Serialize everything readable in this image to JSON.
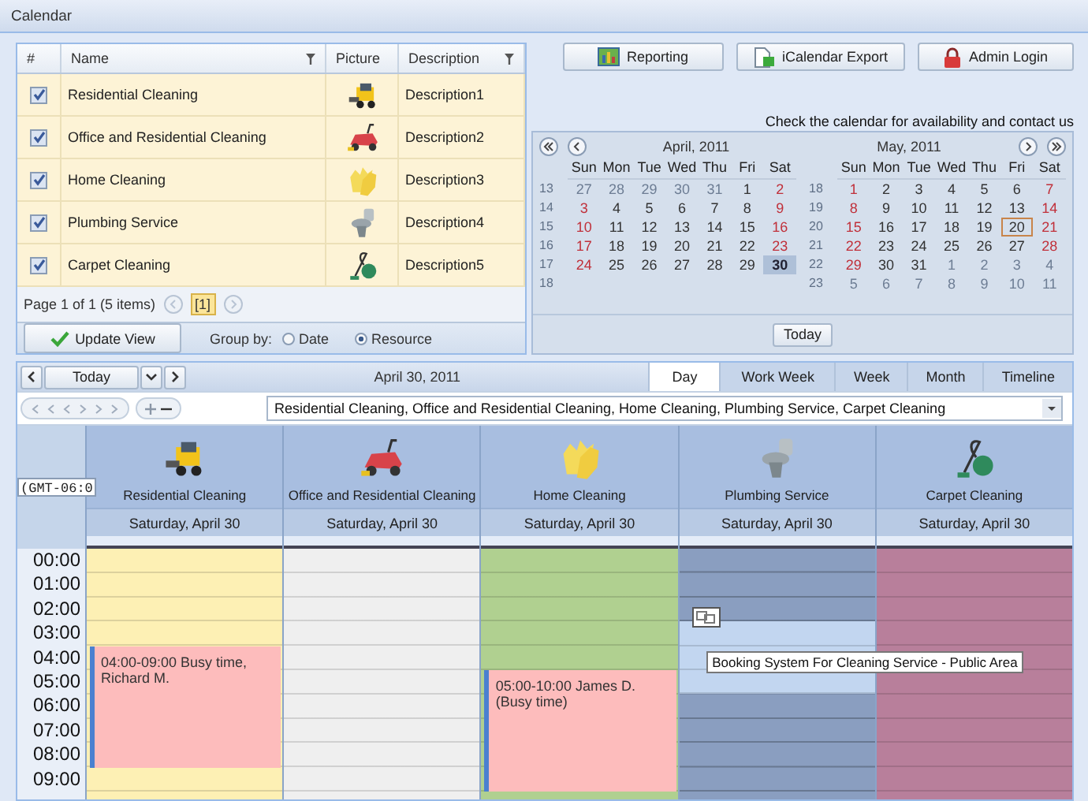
{
  "window": {
    "title": "Calendar"
  },
  "grid": {
    "columns": [
      {
        "label": "#",
        "filter": false
      },
      {
        "label": "Name",
        "filter": true
      },
      {
        "label": "Picture",
        "filter": false
      },
      {
        "label": "Description",
        "filter": true
      }
    ],
    "rows": [
      {
        "checked": true,
        "name": "Residential Cleaning",
        "description": "Description1"
      },
      {
        "checked": true,
        "name": "Office and Residential Cleaning",
        "description": "Description2"
      },
      {
        "checked": true,
        "name": "Home Cleaning",
        "description": "Description3"
      },
      {
        "checked": true,
        "name": "Plumbing Service",
        "description": "Description4"
      },
      {
        "checked": true,
        "name": "Carpet Cleaning",
        "description": "Description5"
      }
    ],
    "pager": {
      "text": "Page 1 of 1 (5 items)",
      "pages": [
        {
          "label": "[1]",
          "selected": true
        }
      ]
    },
    "update_button": "Update View",
    "group_by": {
      "label": "Group by:",
      "options": [
        {
          "label": "Date",
          "selected": false
        },
        {
          "label": "Resource",
          "selected": true
        }
      ]
    }
  },
  "buttons": [
    "Reporting",
    "iCalendar Export",
    "Admin Login"
  ],
  "notice": "Check the calendar for availability and contact us",
  "mini_calendar": {
    "today_button": "Today",
    "months": [
      {
        "title": "April, 2011",
        "day_names": [
          "Sun",
          "Mon",
          "Tue",
          "Wed",
          "Thu",
          "Fri",
          "Sat"
        ],
        "weeks": [
          {
            "number": "13",
            "days": [
              {
                "d": "27",
                "other": true,
                "selected": false,
                "today": false
              },
              {
                "d": "28",
                "other": true,
                "selected": false,
                "today": false
              },
              {
                "d": "29",
                "other": true,
                "selected": false,
                "today": false
              },
              {
                "d": "30",
                "other": true,
                "selected": false,
                "today": false
              },
              {
                "d": "31",
                "other": true,
                "selected": false,
                "today": false
              },
              {
                "d": "1",
                "other": false,
                "selected": false,
                "today": false
              },
              {
                "d": "2",
                "other": false,
                "selected": false,
                "today": false
              }
            ]
          },
          {
            "number": "14",
            "days": [
              {
                "d": "3",
                "other": false,
                "selected": false,
                "today": false
              },
              {
                "d": "4",
                "other": false,
                "selected": false,
                "today": false
              },
              {
                "d": "5",
                "other": false,
                "selected": false,
                "today": false
              },
              {
                "d": "6",
                "other": false,
                "selected": false,
                "today": false
              },
              {
                "d": "7",
                "other": false,
                "selected": false,
                "today": false
              },
              {
                "d": "8",
                "other": false,
                "selected": false,
                "today": false
              },
              {
                "d": "9",
                "other": false,
                "selected": false,
                "today": false
              }
            ]
          },
          {
            "number": "15",
            "days": [
              {
                "d": "10",
                "other": false,
                "selected": false,
                "today": false
              },
              {
                "d": "11",
                "other": false,
                "selected": false,
                "today": false
              },
              {
                "d": "12",
                "other": false,
                "selected": false,
                "today": false
              },
              {
                "d": "13",
                "other": false,
                "selected": false,
                "today": false
              },
              {
                "d": "14",
                "other": false,
                "selected": false,
                "today": false
              },
              {
                "d": "15",
                "other": false,
                "selected": false,
                "today": false
              },
              {
                "d": "16",
                "other": false,
                "selected": false,
                "today": false
              }
            ]
          },
          {
            "number": "16",
            "days": [
              {
                "d": "17",
                "other": false,
                "selected": false,
                "today": false
              },
              {
                "d": "18",
                "other": false,
                "selected": false,
                "today": false
              },
              {
                "d": "19",
                "other": false,
                "selected": false,
                "today": false
              },
              {
                "d": "20",
                "other": false,
                "selected": false,
                "today": false
              },
              {
                "d": "21",
                "other": false,
                "selected": false,
                "today": false
              },
              {
                "d": "22",
                "other": false,
                "selected": false,
                "today": false
              },
              {
                "d": "23",
                "other": false,
                "selected": false,
                "today": false
              }
            ]
          },
          {
            "number": "17",
            "days": [
              {
                "d": "24",
                "other": false,
                "selected": false,
                "today": false
              },
              {
                "d": "25",
                "other": false,
                "selected": false,
                "today": false
              },
              {
                "d": "26",
                "other": false,
                "selected": false,
                "today": false
              },
              {
                "d": "27",
                "other": false,
                "selected": false,
                "today": false
              },
              {
                "d": "28",
                "other": false,
                "selected": false,
                "today": false
              },
              {
                "d": "29",
                "other": false,
                "selected": false,
                "today": false
              },
              {
                "d": "30",
                "other": false,
                "selected": true,
                "today": false
              }
            ]
          },
          {
            "number": "18"
          }
        ]
      },
      {
        "title": "May, 2011",
        "day_names": [
          "Sun",
          "Mon",
          "Tue",
          "Wed",
          "Thu",
          "Fri",
          "Sat"
        ],
        "weeks": [
          {
            "number": "18",
            "days": [
              {
                "d": "1",
                "other": false,
                "selected": false,
                "today": false
              },
              {
                "d": "2",
                "other": false,
                "selected": false,
                "today": false
              },
              {
                "d": "3",
                "other": false,
                "selected": false,
                "today": false
              },
              {
                "d": "4",
                "other": false,
                "selected": false,
                "today": false
              },
              {
                "d": "5",
                "other": false,
                "selected": false,
                "today": false
              },
              {
                "d": "6",
                "other": false,
                "selected": false,
                "today": false
              },
              {
                "d": "7",
                "other": false,
                "selected": false,
                "today": false
              }
            ]
          },
          {
            "number": "19",
            "days": [
              {
                "d": "8",
                "other": false,
                "selected": false,
                "today": false
              },
              {
                "d": "9",
                "other": false,
                "selected": false,
                "today": false
              },
              {
                "d": "10",
                "other": false,
                "selected": false,
                "today": false
              },
              {
                "d": "11",
                "other": false,
                "selected": false,
                "today": false
              },
              {
                "d": "12",
                "other": false,
                "selected": false,
                "today": false
              },
              {
                "d": "13",
                "other": false,
                "selected": false,
                "today": false
              },
              {
                "d": "14",
                "other": false,
                "selected": false,
                "today": false
              }
            ]
          },
          {
            "number": "20",
            "days": [
              {
                "d": "15",
                "other": false,
                "selected": false,
                "today": false
              },
              {
                "d": "16",
                "other": false,
                "selected": false,
                "today": false
              },
              {
                "d": "17",
                "other": false,
                "selected": false,
                "today": false
              },
              {
                "d": "18",
                "other": false,
                "selected": false,
                "today": false
              },
              {
                "d": "19",
                "other": false,
                "selected": false,
                "today": false
              },
              {
                "d": "20",
                "other": false,
                "selected": false,
                "today": true
              },
              {
                "d": "21",
                "other": false,
                "selected": false,
                "today": false
              }
            ]
          },
          {
            "number": "21",
            "days": [
              {
                "d": "22",
                "other": false,
                "selected": false,
                "today": false
              },
              {
                "d": "23",
                "other": false,
                "selected": false,
                "today": false
              },
              {
                "d": "24",
                "other": false,
                "selected": false,
                "today": false
              },
              {
                "d": "25",
                "other": false,
                "selected": false,
                "today": false
              },
              {
                "d": "26",
                "other": false,
                "selected": false,
                "today": false
              },
              {
                "d": "27",
                "other": false,
                "selected": false,
                "today": false
              },
              {
                "d": "28",
                "other": false,
                "selected": false,
                "today": false
              }
            ]
          },
          {
            "number": "22",
            "days": [
              {
                "d": "29",
                "other": false,
                "selected": false,
                "today": false
              },
              {
                "d": "30",
                "other": false,
                "selected": false,
                "today": false
              },
              {
                "d": "31",
                "other": false,
                "selected": false,
                "today": false
              },
              {
                "d": "1",
                "other": true,
                "selected": false,
                "today": false
              },
              {
                "d": "2",
                "other": true,
                "selected": false,
                "today": false
              },
              {
                "d": "3",
                "other": true,
                "selected": false,
                "today": false
              },
              {
                "d": "4",
                "other": true,
                "selected": false,
                "today": false
              }
            ]
          },
          {
            "number": "23",
            "days": [
              {
                "d": "5",
                "other": true,
                "selected": false,
                "today": false
              },
              {
                "d": "6",
                "other": true,
                "selected": false,
                "today": false
              },
              {
                "d": "7",
                "other": true,
                "selected": false,
                "today": false
              },
              {
                "d": "8",
                "other": true,
                "selected": false,
                "today": false
              },
              {
                "d": "9",
                "other": true,
                "selected": false,
                "today": false
              },
              {
                "d": "10",
                "other": true,
                "selected": false,
                "today": false
              },
              {
                "d": "11",
                "other": true,
                "selected": false,
                "today": false
              }
            ]
          }
        ]
      }
    ]
  },
  "scheduler": {
    "today": "Today",
    "date": "April 30, 2011",
    "views": [
      {
        "label": "Day",
        "selected": true
      },
      {
        "label": "Work Week",
        "selected": false
      },
      {
        "label": "Week",
        "selected": false
      },
      {
        "label": "Month",
        "selected": false
      },
      {
        "label": "Timeline",
        "selected": false
      }
    ],
    "resource_filter": "Residential Cleaning, Office and Residential Cleaning, Home Cleaning, Plumbing Service, Carpet Cleaning",
    "timezone": "(GMT-06:0",
    "hours": [
      "00:00",
      "01:00",
      "02:00",
      "03:00",
      "04:00",
      "05:00",
      "06:00",
      "07:00",
      "08:00",
      "09:00"
    ],
    "resources": [
      {
        "name": "Residential Cleaning",
        "date": "Saturday, April 30",
        "color": "#fdf0b4",
        "events": [
          {
            "time": "04:00-09:00",
            "text": "Busy time, Richard M."
          }
        ]
      },
      {
        "name": "Office and Residential Cleaning",
        "date": "Saturday, April 30",
        "color": "#efefef"
      },
      {
        "name": "Home Cleaning",
        "date": "Saturday, April 30",
        "color": "#b0d090",
        "events": [
          {
            "time": "05:00-10:00",
            "text": "James D. (Busy time)"
          }
        ]
      },
      {
        "name": "Plumbing Service",
        "date": "Saturday, April 30",
        "color": "#8a9ec0",
        "slots": [
          {
            "selected": false
          },
          {
            "selected": false
          },
          {
            "selected": false
          },
          {
            "selected": true
          },
          {
            "selected": true
          },
          {
            "selected": true
          },
          {
            "selected": false
          },
          {
            "selected": false
          },
          {
            "selected": false
          },
          {
            "selected": false
          }
        ]
      },
      {
        "name": "Carpet Cleaning",
        "date": "Saturday, April 30",
        "color": "#b87f9b"
      }
    ],
    "tooltip": "Booking System For Cleaning Service - Public Area"
  }
}
